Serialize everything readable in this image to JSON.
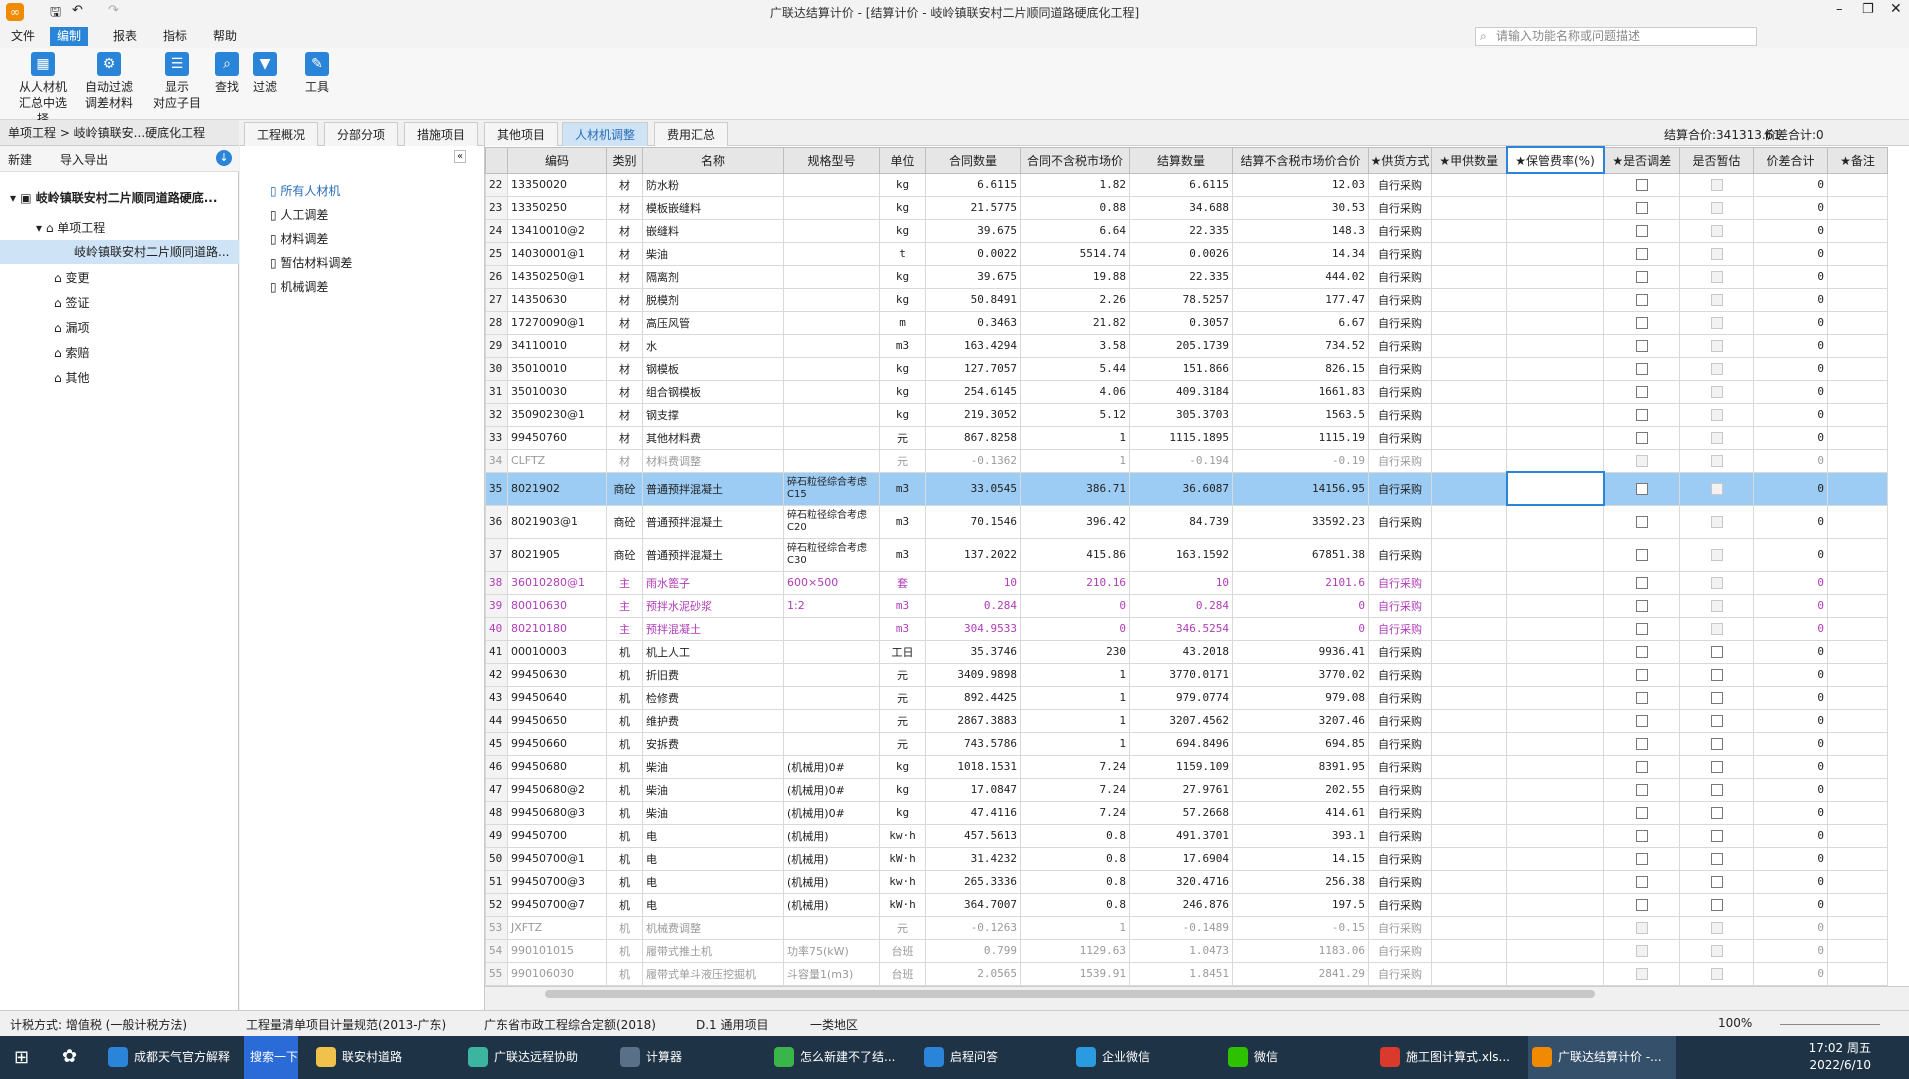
{
  "window": {
    "title": "广联达结算计价 - [结算计价 - 岐岭镇联安村二片顺同道路硬底化工程]"
  },
  "menu": {
    "items": [
      "文件",
      "编制",
      "报表",
      "指标",
      "帮助"
    ],
    "active": "编制",
    "search_placeholder": "请输入功能名称或问题描述"
  },
  "ribbon": {
    "buttons": [
      {
        "label1": "从人材机",
        "label2": "汇总中选择"
      },
      {
        "label1": "自动过滤",
        "label2": "调差材料"
      },
      {
        "label1": "显示",
        "label2": "对应子目"
      },
      {
        "label1": "查找",
        "label2": ""
      },
      {
        "label1": "过滤",
        "label2": ""
      },
      {
        "label1": "工具",
        "label2": ""
      }
    ]
  },
  "left": {
    "breadcrumb": "单项工程 > 岐岭镇联安...硬底化工程",
    "tool_new": "新建",
    "tool_import": "导入导出",
    "tree": [
      {
        "label": "岐岭镇联安村二片顺同道路硬底..."
      },
      {
        "label": "单项工程"
      },
      {
        "label": "岐岭镇联安村二片顺同道路..."
      },
      {
        "label": "变更"
      },
      {
        "label": "签证"
      },
      {
        "label": "漏项"
      },
      {
        "label": "索赔"
      },
      {
        "label": "其他"
      }
    ]
  },
  "mid": {
    "items": [
      "所有人材机",
      "人工调差",
      "材料调差",
      "暂估材料调差",
      "机械调差"
    ]
  },
  "tabs": [
    "工程概况",
    "分部分项",
    "措施项目",
    "其他项目",
    "人材机调整",
    "费用汇总"
  ],
  "active_tab": "人材机调整",
  "summary": {
    "total": "结算合价:341313.61",
    "diff": "价差合计:0"
  },
  "grid": {
    "columns": [
      "编码",
      "类别",
      "名称",
      "规格型号",
      "单位",
      "合同数量",
      "合同不含税市场价",
      "结算数量",
      "结算不含税市场价合价",
      "★供货方式",
      "★甲供数量",
      "★保管费率(%)",
      "★是否调差",
      "是否暂估",
      "价差合计",
      "★备注"
    ],
    "rows": [
      {
        "n": "22",
        "code": "13350020",
        "cat": "材",
        "name": "防水粉",
        "spec": "",
        "unit": "kg",
        "cq": "6.6115",
        "cp": "1.82",
        "sq": "6.6115",
        "sp": "12.03",
        "sup": "自行采购",
        "diff": "0"
      },
      {
        "n": "23",
        "code": "13350250",
        "cat": "材",
        "name": "模板嵌缝料",
        "spec": "",
        "unit": "kg",
        "cq": "21.5775",
        "cp": "0.88",
        "sq": "34.688",
        "sp": "30.53",
        "sup": "自行采购",
        "diff": "0"
      },
      {
        "n": "24",
        "code": "13410010@2",
        "cat": "材",
        "name": "嵌缝料",
        "spec": "",
        "unit": "kg",
        "cq": "39.675",
        "cp": "6.64",
        "sq": "22.335",
        "sp": "148.3",
        "sup": "自行采购",
        "diff": "0"
      },
      {
        "n": "25",
        "code": "14030001@1",
        "cat": "材",
        "name": "柴油",
        "spec": "",
        "unit": "t",
        "cq": "0.0022",
        "cp": "5514.74",
        "sq": "0.0026",
        "sp": "14.34",
        "sup": "自行采购",
        "diff": "0"
      },
      {
        "n": "26",
        "code": "14350250@1",
        "cat": "材",
        "name": "隔离剂",
        "spec": "",
        "unit": "kg",
        "cq": "39.675",
        "cp": "19.88",
        "sq": "22.335",
        "sp": "444.02",
        "sup": "自行采购",
        "diff": "0"
      },
      {
        "n": "27",
        "code": "14350630",
        "cat": "材",
        "name": "脱模剂",
        "spec": "",
        "unit": "kg",
        "cq": "50.8491",
        "cp": "2.26",
        "sq": "78.5257",
        "sp": "177.47",
        "sup": "自行采购",
        "diff": "0"
      },
      {
        "n": "28",
        "code": "17270090@1",
        "cat": "材",
        "name": "高压风管",
        "spec": "",
        "unit": "m",
        "cq": "0.3463",
        "cp": "21.82",
        "sq": "0.3057",
        "sp": "6.67",
        "sup": "自行采购",
        "diff": "0"
      },
      {
        "n": "29",
        "code": "34110010",
        "cat": "材",
        "name": "水",
        "spec": "",
        "unit": "m3",
        "cq": "163.4294",
        "cp": "3.58",
        "sq": "205.1739",
        "sp": "734.52",
        "sup": "自行采购",
        "diff": "0"
      },
      {
        "n": "30",
        "code": "35010010",
        "cat": "材",
        "name": "钢模板",
        "spec": "",
        "unit": "kg",
        "cq": "127.7057",
        "cp": "5.44",
        "sq": "151.866",
        "sp": "826.15",
        "sup": "自行采购",
        "diff": "0"
      },
      {
        "n": "31",
        "code": "35010030",
        "cat": "材",
        "name": "组合钢模板",
        "spec": "",
        "unit": "kg",
        "cq": "254.6145",
        "cp": "4.06",
        "sq": "409.3184",
        "sp": "1661.83",
        "sup": "自行采购",
        "diff": "0"
      },
      {
        "n": "32",
        "code": "35090230@1",
        "cat": "材",
        "name": "钢支撑",
        "spec": "",
        "unit": "kg",
        "cq": "219.3052",
        "cp": "5.12",
        "sq": "305.3703",
        "sp": "1563.5",
        "sup": "自行采购",
        "diff": "0"
      },
      {
        "n": "33",
        "code": "99450760",
        "cat": "材",
        "name": "其他材料费",
        "spec": "",
        "unit": "元",
        "cq": "867.8258",
        "cp": "1",
        "sq": "1115.1895",
        "sp": "1115.19",
        "sup": "自行采购",
        "diff": "0"
      },
      {
        "n": "34",
        "code": "CLFTZ",
        "cat": "材",
        "name": "材料费调整",
        "spec": "",
        "unit": "元",
        "cq": "-0.1362",
        "cp": "1",
        "sq": "-0.194",
        "sp": "-0.19",
        "sup": "自行采购",
        "diff": "0",
        "style": "grey"
      },
      {
        "n": "35",
        "code": "8021902",
        "cat": "商砼",
        "name": "普通预拌混凝土",
        "spec": "碎石粒径综合考虑 C15",
        "unit": "m3",
        "cq": "33.0545",
        "cp": "386.71",
        "sq": "36.6087",
        "sp": "14156.95",
        "sup": "自行采购",
        "diff": "0",
        "style": "sel",
        "tall": true
      },
      {
        "n": "36",
        "code": "8021903@1",
        "cat": "商砼",
        "name": "普通预拌混凝土",
        "spec": "碎石粒径综合考虑 C20",
        "unit": "m3",
        "cq": "70.1546",
        "cp": "396.42",
        "sq": "84.739",
        "sp": "33592.23",
        "sup": "自行采购",
        "diff": "0",
        "tall": true
      },
      {
        "n": "37",
        "code": "8021905",
        "cat": "商砼",
        "name": "普通预拌混凝土",
        "spec": "碎石粒径综合考虑 C30",
        "unit": "m3",
        "cq": "137.2022",
        "cp": "415.86",
        "sq": "163.1592",
        "sp": "67851.38",
        "sup": "自行采购",
        "diff": "0",
        "tall": true
      },
      {
        "n": "38",
        "code": "36010280@1",
        "cat": "主",
        "name": "雨水篦子",
        "spec": "600×500",
        "unit": "套",
        "cq": "10",
        "cp": "210.16",
        "sq": "10",
        "sp": "2101.6",
        "sup": "自行采购",
        "diff": "0",
        "style": "purple"
      },
      {
        "n": "39",
        "code": "80010630",
        "cat": "主",
        "name": "预拌水泥砂浆",
        "spec": "1:2",
        "unit": "m3",
        "cq": "0.284",
        "cp": "0",
        "sq": "0.284",
        "sp": "0",
        "sup": "自行采购",
        "diff": "0",
        "style": "purple"
      },
      {
        "n": "40",
        "code": "80210180",
        "cat": "主",
        "name": "预拌混凝土",
        "spec": "",
        "unit": "m3",
        "cq": "304.9533",
        "cp": "0",
        "sq": "346.5254",
        "sp": "0",
        "sup": "自行采购",
        "diff": "0",
        "style": "purple"
      },
      {
        "n": "41",
        "code": "00010003",
        "cat": "机",
        "name": "机上人工",
        "spec": "",
        "unit": "工日",
        "cq": "35.3746",
        "cp": "230",
        "sq": "43.2018",
        "sp": "9936.41",
        "sup": "自行采购",
        "diff": "0"
      },
      {
        "n": "42",
        "code": "99450630",
        "cat": "机",
        "name": "折旧费",
        "spec": "",
        "unit": "元",
        "cq": "3409.9898",
        "cp": "1",
        "sq": "3770.0171",
        "sp": "3770.02",
        "sup": "自行采购",
        "diff": "0"
      },
      {
        "n": "43",
        "code": "99450640",
        "cat": "机",
        "name": "检修费",
        "spec": "",
        "unit": "元",
        "cq": "892.4425",
        "cp": "1",
        "sq": "979.0774",
        "sp": "979.08",
        "sup": "自行采购",
        "diff": "0"
      },
      {
        "n": "44",
        "code": "99450650",
        "cat": "机",
        "name": "维护费",
        "spec": "",
        "unit": "元",
        "cq": "2867.3883",
        "cp": "1",
        "sq": "3207.4562",
        "sp": "3207.46",
        "sup": "自行采购",
        "diff": "0"
      },
      {
        "n": "45",
        "code": "99450660",
        "cat": "机",
        "name": "安拆费",
        "spec": "",
        "unit": "元",
        "cq": "743.5786",
        "cp": "1",
        "sq": "694.8496",
        "sp": "694.85",
        "sup": "自行采购",
        "diff": "0"
      },
      {
        "n": "46",
        "code": "99450680",
        "cat": "机",
        "name": "柴油",
        "spec": "(机械用)0#",
        "unit": "kg",
        "cq": "1018.1531",
        "cp": "7.24",
        "sq": "1159.109",
        "sp": "8391.95",
        "sup": "自行采购",
        "diff": "0"
      },
      {
        "n": "47",
        "code": "99450680@2",
        "cat": "机",
        "name": "柴油",
        "spec": "(机械用)0#",
        "unit": "kg",
        "cq": "17.0847",
        "cp": "7.24",
        "sq": "27.9761",
        "sp": "202.55",
        "sup": "自行采购",
        "diff": "0"
      },
      {
        "n": "48",
        "code": "99450680@3",
        "cat": "机",
        "name": "柴油",
        "spec": "(机械用)0#",
        "unit": "kg",
        "cq": "47.4116",
        "cp": "7.24",
        "sq": "57.2668",
        "sp": "414.61",
        "sup": "自行采购",
        "diff": "0"
      },
      {
        "n": "49",
        "code": "99450700",
        "cat": "机",
        "name": "电",
        "spec": "(机械用)",
        "unit": "kw·h",
        "cq": "457.5613",
        "cp": "0.8",
        "sq": "491.3701",
        "sp": "393.1",
        "sup": "自行采购",
        "diff": "0"
      },
      {
        "n": "50",
        "code": "99450700@1",
        "cat": "机",
        "name": "电",
        "spec": "(机械用)",
        "unit": "kW·h",
        "cq": "31.4232",
        "cp": "0.8",
        "sq": "17.6904",
        "sp": "14.15",
        "sup": "自行采购",
        "diff": "0"
      },
      {
        "n": "51",
        "code": "99450700@3",
        "cat": "机",
        "name": "电",
        "spec": "(机械用)",
        "unit": "kw·h",
        "cq": "265.3336",
        "cp": "0.8",
        "sq": "320.4716",
        "sp": "256.38",
        "sup": "自行采购",
        "diff": "0"
      },
      {
        "n": "52",
        "code": "99450700@7",
        "cat": "机",
        "name": "电",
        "spec": "(机械用)",
        "unit": "kW·h",
        "cq": "364.7007",
        "cp": "0.8",
        "sq": "246.876",
        "sp": "197.5",
        "sup": "自行采购",
        "diff": "0"
      },
      {
        "n": "53",
        "code": "JXFTZ",
        "cat": "机",
        "name": "机械费调整",
        "spec": "",
        "unit": "元",
        "cq": "-0.1263",
        "cp": "1",
        "sq": "-0.1489",
        "sp": "-0.15",
        "sup": "自行采购",
        "diff": "0",
        "style": "grey"
      },
      {
        "n": "54",
        "code": "990101015",
        "cat": "机",
        "name": "履带式推土机",
        "spec": "功率75(kW)",
        "unit": "台班",
        "cq": "0.799",
        "cp": "1129.63",
        "sq": "1.0473",
        "sp": "1183.06",
        "sup": "自行采购",
        "diff": "0",
        "style": "grey"
      },
      {
        "n": "55",
        "code": "990106030",
        "cat": "机",
        "name": "履带式单斗液压挖掘机",
        "spec": "斗容量1(m3)",
        "unit": "台班",
        "cq": "2.0565",
        "cp": "1539.91",
        "sq": "1.8451",
        "sp": "2841.29",
        "sup": "自行采购",
        "diff": "0",
        "style": "grey"
      }
    ]
  },
  "status": {
    "tax": "计税方式: 增值税 (一般计税方法)",
    "norm": "工程量清单项目计量规范(2013-广东)",
    "quota": "广东省市政工程综合定额(2018)",
    "proj": "D.1 通用项目",
    "area": "一类地区",
    "zoom": "100%"
  },
  "taskbar": {
    "items": [
      "成都天气官方解释",
      "搜索一下",
      "联安村道路",
      "广联达远程协助",
      "计算器",
      "怎么新建不了结...",
      "启程问答",
      "企业微信",
      "微信",
      "施工图计算式.xls...",
      "广联达结算计价 -..."
    ],
    "time": "17:02 周五",
    "date": "2022/6/10"
  },
  "colors": {
    "accent": "#2a85d8",
    "selected_row": "#9ccbf3",
    "purple_text": "#b03cb8",
    "grey_text": "#9a9a9a",
    "taskbar": "#1f3346"
  }
}
